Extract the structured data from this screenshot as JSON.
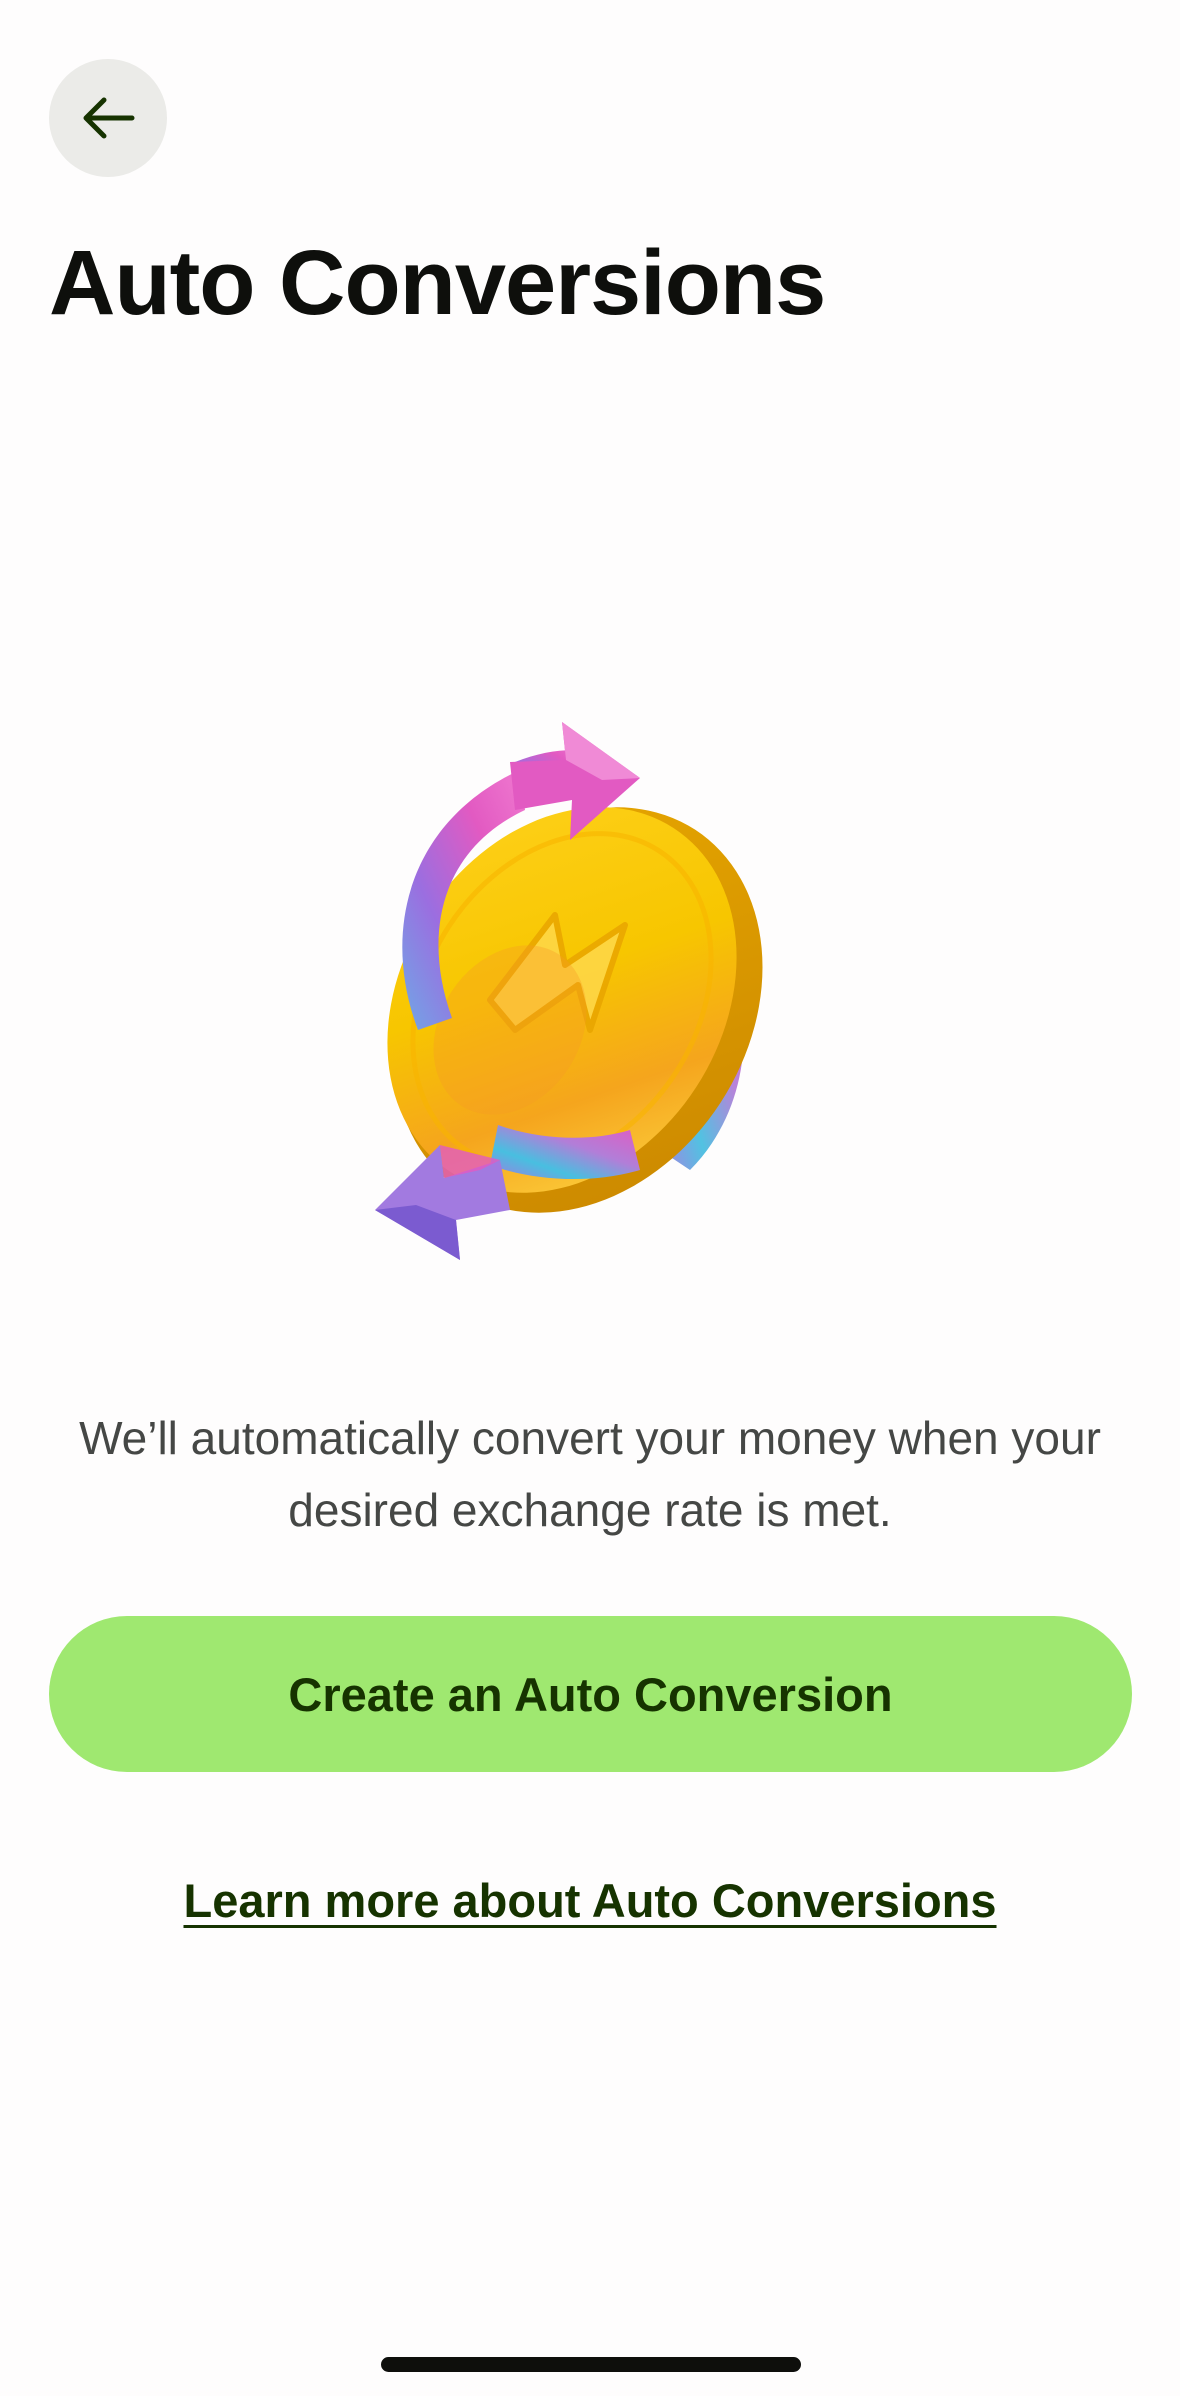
{
  "header": {
    "back_icon": "arrow-left-icon",
    "title": "Auto Conversions"
  },
  "illustration": {
    "icon": "coin-conversion-arrows-illustration",
    "colors": {
      "coin": "#f7c600",
      "coin_edge": "#e8a800",
      "arrow_pink": "#e25ac2",
      "arrow_purple": "#9b6ee0",
      "arrow_cyan": "#48bfe0"
    }
  },
  "main": {
    "description": "We’ll automatically convert your money when your desired exchange rate is met.",
    "primary_button_label": "Create an Auto Conversion",
    "learn_more_link": "Learn more about Auto Conversions"
  },
  "colors": {
    "background": "#fefdfd",
    "accent_button": "#9fe870",
    "button_text": "#163300",
    "title_text": "#0e0f0c",
    "body_text": "#454745"
  }
}
